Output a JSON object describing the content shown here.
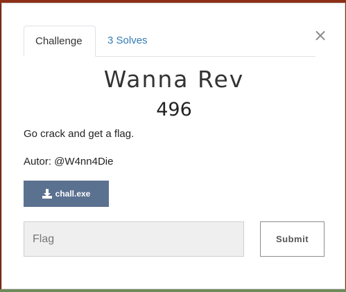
{
  "modal": {
    "close_label": "×",
    "tabs": [
      {
        "label": "Challenge"
      },
      {
        "label": "3 Solves"
      }
    ],
    "title": "Wanna Rev",
    "points": "496",
    "description": "Go crack and get a flag.",
    "author": "Autor: @W4nn4Die",
    "file": {
      "label": "chall.exe",
      "icon": "download-icon"
    },
    "flag_input": {
      "placeholder": "Flag",
      "value": ""
    },
    "submit_label": "Submit"
  },
  "colors": {
    "backdrop": "#7a2a14",
    "file_button": "#5b7190",
    "tab_link": "#337ab7"
  }
}
